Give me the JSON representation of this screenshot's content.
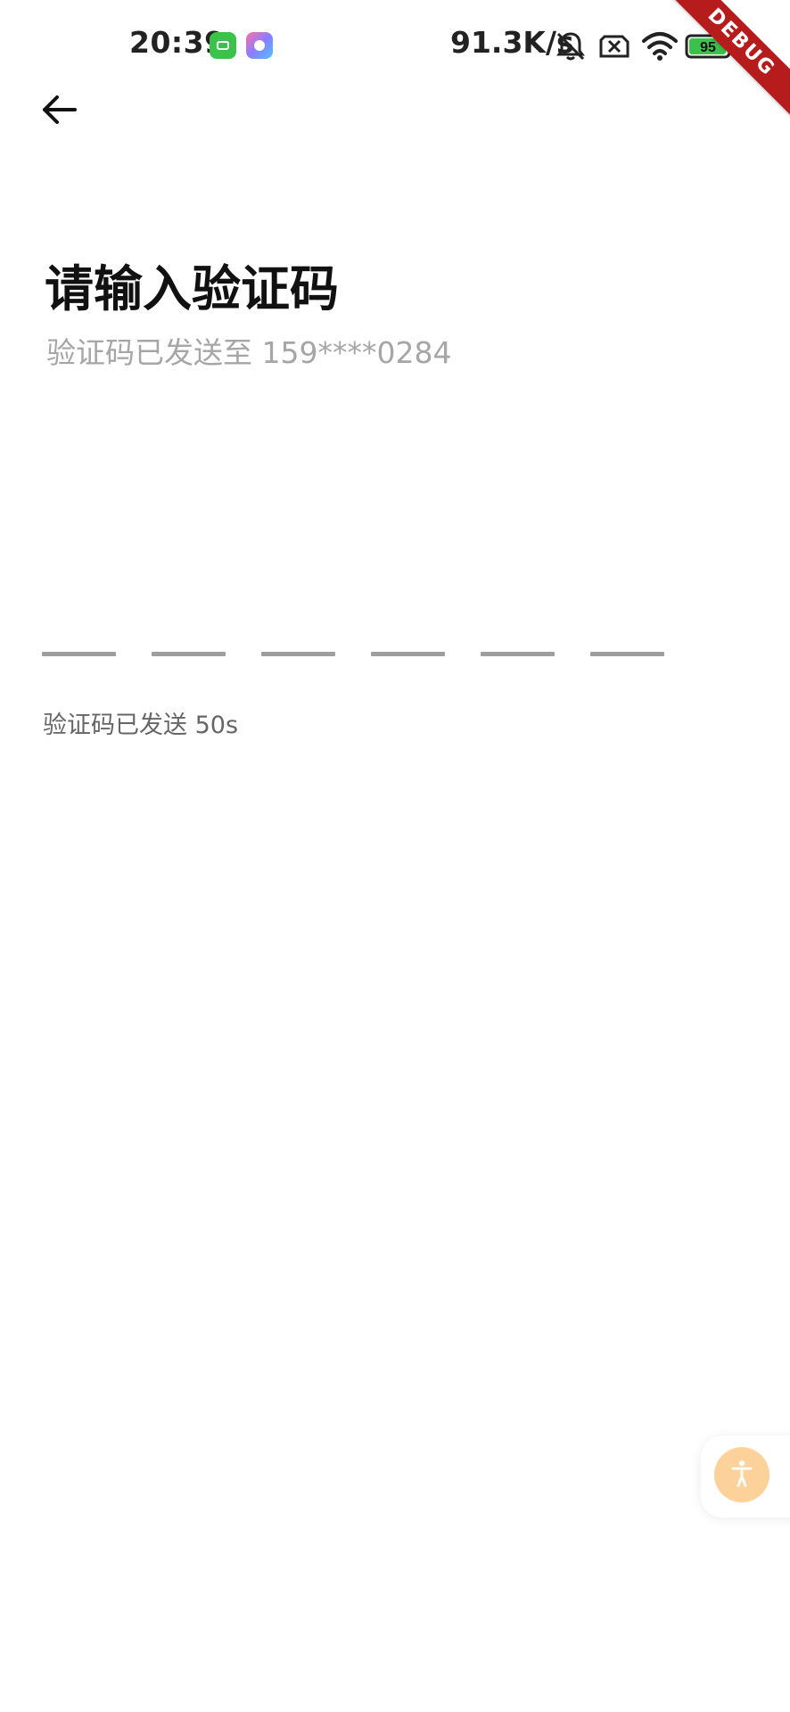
{
  "status_bar": {
    "time": "20:39",
    "net_speed": "91.3K/s",
    "battery_level": "95",
    "icons": [
      "app-green-icon",
      "app-multicolor-icon",
      "bell-muted-icon",
      "sim-none-icon",
      "wifi-icon",
      "battery-icon"
    ]
  },
  "debug_banner": {
    "label": "DEBUG",
    "color": "#b71c1c"
  },
  "header": {
    "back_icon": "arrow-left-icon"
  },
  "main": {
    "title": "请输入验证码",
    "subtitle": "验证码已发送至 159****0284",
    "code_length": 6,
    "code_values": [
      "",
      "",
      "",
      "",
      "",
      ""
    ],
    "resend_status": "验证码已发送 50s"
  },
  "floating_button": {
    "icon": "accessibility-icon",
    "color": "#fcd29a"
  }
}
